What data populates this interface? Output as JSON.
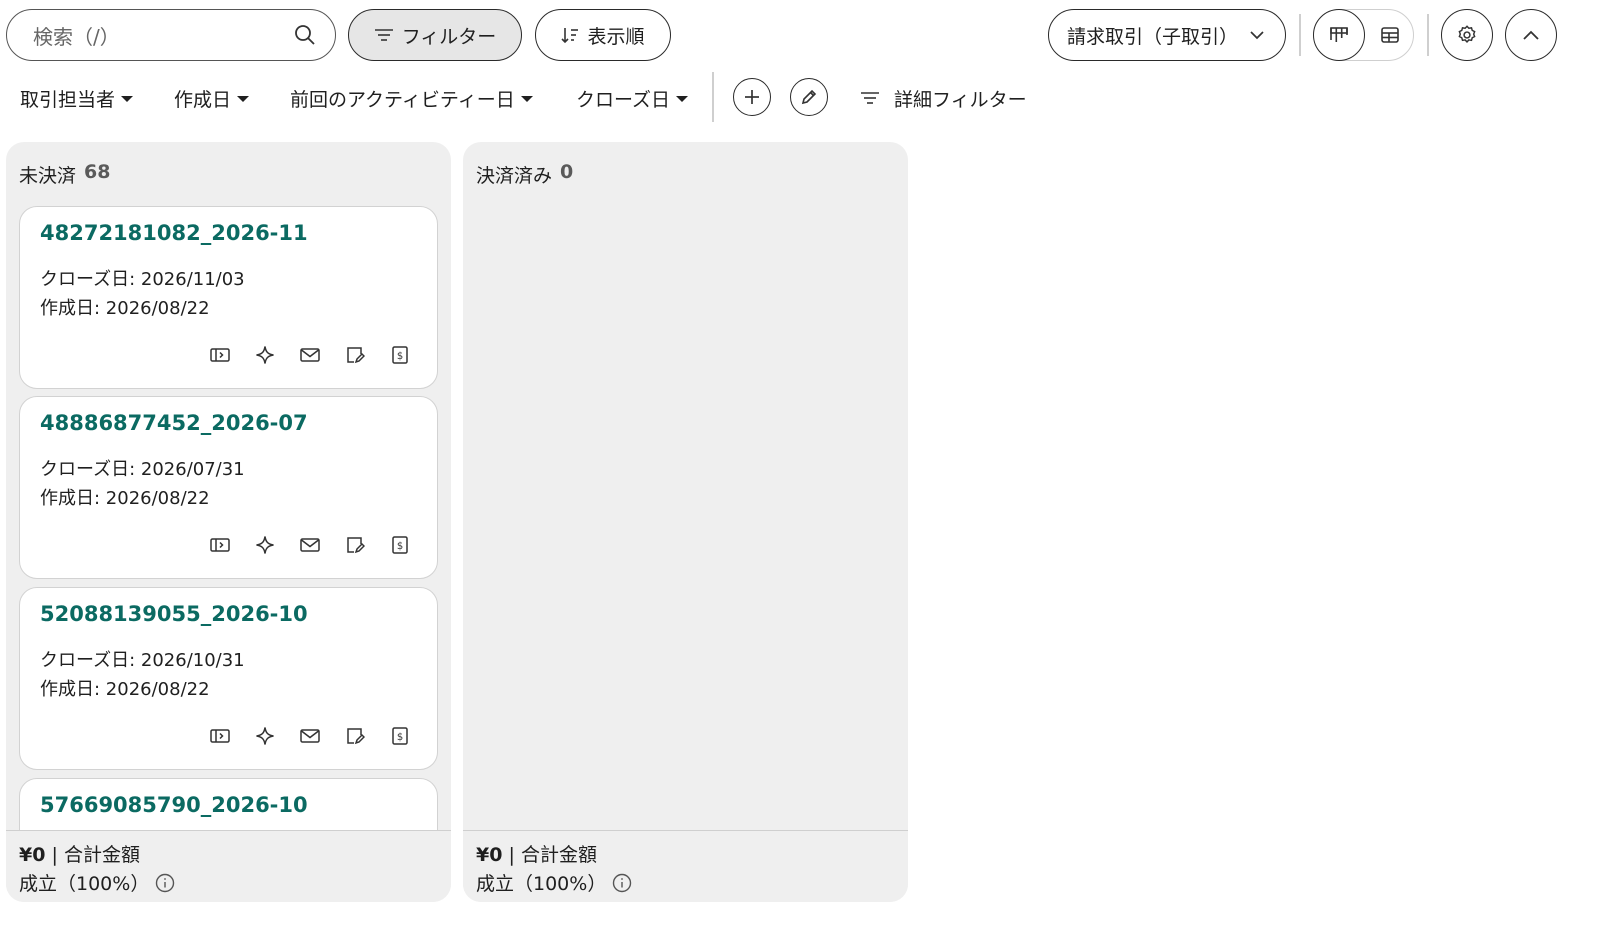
{
  "toolbar": {
    "search_placeholder": "検索（/）",
    "filter_label": "フィルター",
    "sort_label": "表示順",
    "pipeline_label": "請求取引（子取引）"
  },
  "quick_filters": [
    {
      "label": "取引担当者"
    },
    {
      "label": "作成日"
    },
    {
      "label": "前回のアクティビティー日"
    },
    {
      "label": "クローズ日"
    }
  ],
  "advanced_filter_label": "詳細フィルター",
  "columns": [
    {
      "title": "未決済",
      "count": "68",
      "cards": [
        {
          "title": "48272181082_2026-11",
          "close": "クローズ日: 2026/11/03",
          "created": "作成日: 2026/08/22"
        },
        {
          "title": "48886877452_2026-07",
          "close": "クローズ日: 2026/07/31",
          "created": "作成日: 2026/08/22"
        },
        {
          "title": "52088139055_2026-10",
          "close": "クローズ日: 2026/10/31",
          "created": "作成日: 2026/08/22"
        },
        {
          "title": "57669085790_2026-10",
          "close": "",
          "created": ""
        }
      ],
      "footer": {
        "amount": "¥0",
        "sep": " | ",
        "amount_label": "合計金額",
        "rate": "成立（100%）"
      }
    },
    {
      "title": "決済済み",
      "count": "0",
      "cards": [],
      "footer": {
        "amount": "¥0",
        "sep": " | ",
        "amount_label": "合計金額",
        "rate": "成立（100%）"
      }
    }
  ],
  "colors": {
    "accent": "#0b6a62",
    "column_bg": "#efefef",
    "border": "#2a2a2a"
  }
}
